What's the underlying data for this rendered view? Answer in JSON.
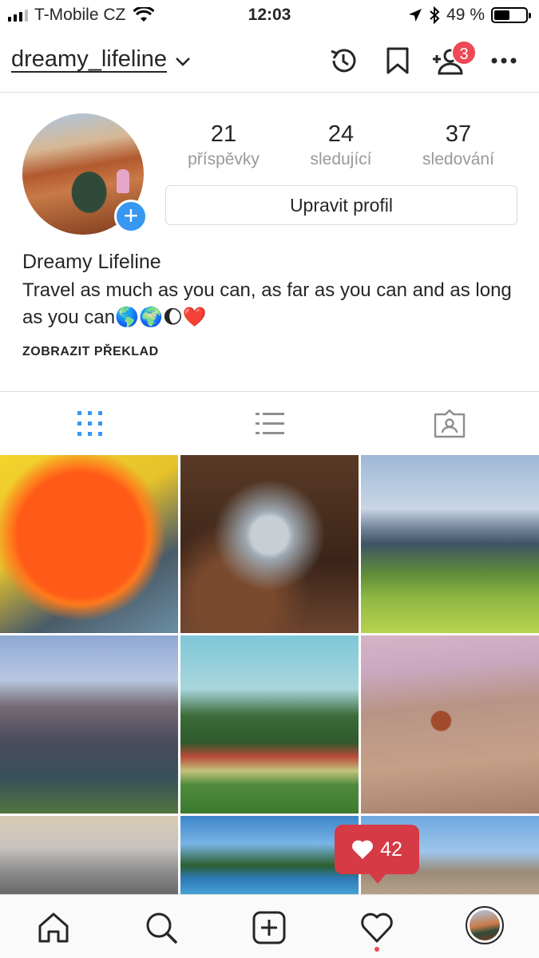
{
  "status_bar": {
    "carrier": "T-Mobile CZ",
    "time": "12:03",
    "battery_percent": "49 %",
    "battery_level": 0.49
  },
  "topnav": {
    "username": "dreamy_lifeline",
    "notification_count": "3"
  },
  "profile": {
    "stats": [
      {
        "value": "21",
        "label": "příspěvky"
      },
      {
        "value": "24",
        "label": "sledující"
      },
      {
        "value": "37",
        "label": "sledování"
      }
    ],
    "edit_button": "Upravit profil",
    "full_name": "Dreamy Lifeline",
    "bio": "Travel as much as you can, as far as you can and as long as you can🌎🌍🌔❤️",
    "translate": "ZOBRAZIT PŘEKLAD"
  },
  "tabs": [
    "grid-icon",
    "list-icon",
    "tagged-icon"
  ],
  "active_tab": "grid-icon",
  "grid": {
    "images": [
      "orange-painted-photo",
      "silversword-plant",
      "alpine-meadow-lake",
      "mountain-valley",
      "palm-garden",
      "muffin-on-beach",
      "city-skyline",
      "tropical-beach",
      "canyon-sky"
    ]
  },
  "like_notification": {
    "count": "42"
  },
  "bottom_nav": [
    "home-icon",
    "search-icon",
    "add-post-icon",
    "activity-icon",
    "profile-avatar"
  ],
  "colors": {
    "accent": "#3897f0",
    "badge": "#ed4956",
    "like_bubble": "#d63a45"
  }
}
